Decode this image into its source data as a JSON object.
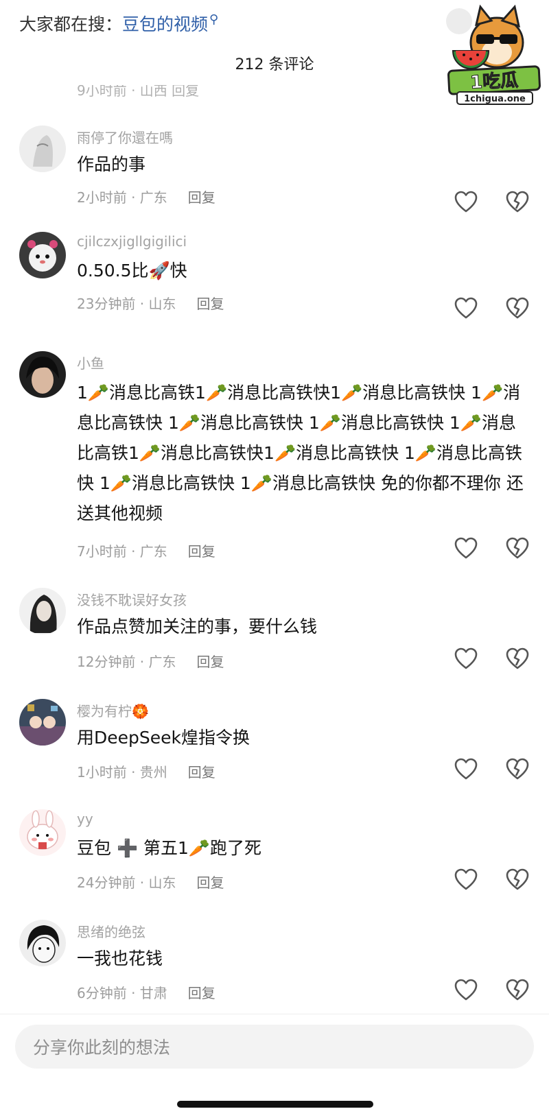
{
  "header": {
    "search_prefix": "大家都在搜：",
    "search_query": "豆包的视频",
    "comment_count_label": "212 条评论",
    "truncated_meta": "9小时前 · 山西   回复"
  },
  "watermark": {
    "brand_text": "1吃瓜",
    "domain_text": "1chigua.one"
  },
  "comments": [
    {
      "username": "雨停了你還在嗎",
      "text": "作品的事",
      "time_location": "2小时前 · 广东",
      "reply": "回复"
    },
    {
      "username": "cjilczxjigllgigilici",
      "text": "0.50.5比🚀快",
      "time_location": "23分钟前 · 山东",
      "reply": "回复"
    },
    {
      "username": "小鱼",
      "text": "1🥕消息比高铁1🥕消息比高铁快1🥕消息比高铁快 1🥕消息比高铁快 1🥕消息比高铁快 1🥕消息比高铁快 1🥕消息比高铁1🥕消息比高铁快1🥕消息比高铁快 1🥕消息比高铁快 1🥕消息比高铁快 1🥕消息比高铁快 免的你都不理你 还送其他视频",
      "time_location": "7小时前 · 广东",
      "reply": "回复"
    },
    {
      "username": "没钱不耽误好女孩",
      "text": "作品点赞加关注的事，要什么钱",
      "time_location": "12分钟前 · 广东",
      "reply": "回复"
    },
    {
      "username": "樱为有柠🏵️",
      "text": "用DeepSeek煌指令换",
      "time_location": "1小时前 · 贵州",
      "reply": "回复"
    },
    {
      "username": "yy",
      "text": "豆包 ➕ 第五1🥕跑了死",
      "time_location": "24分钟前 · 山东",
      "reply": "回复"
    },
    {
      "username": "思绪的绝弦",
      "text": "一我也花钱",
      "time_location": "6分钟前 · 甘肃",
      "reply": "回复"
    }
  ],
  "input": {
    "placeholder": "分享你此刻的想法"
  },
  "icons": {
    "like": "heart-icon",
    "dislike": "broken-heart-icon"
  },
  "colors": {
    "query_link": "#2f5fa8",
    "meta_text": "#9c9c9c",
    "username": "#a3a3a3"
  }
}
